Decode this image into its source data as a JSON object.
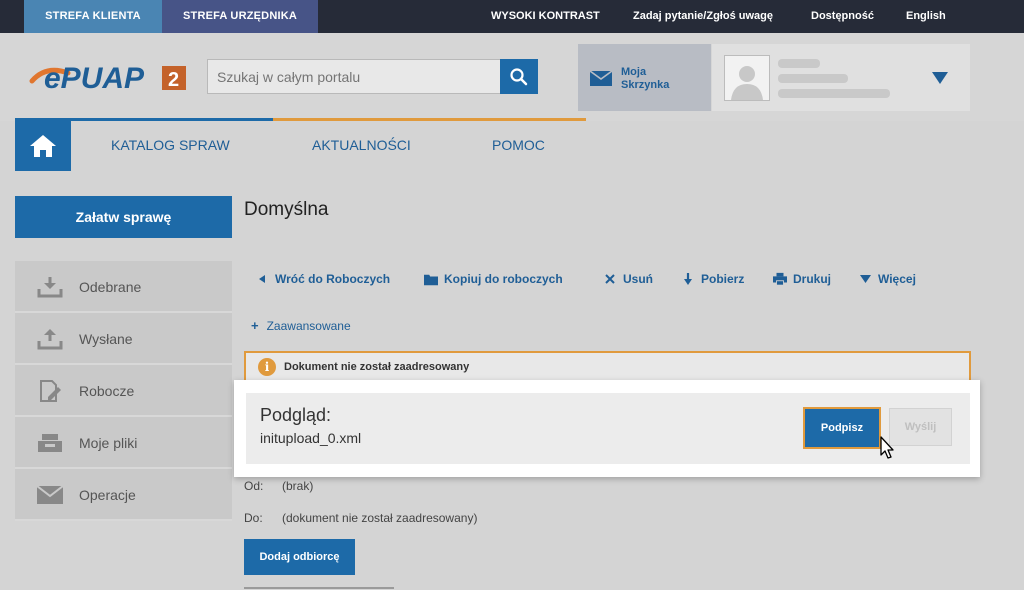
{
  "topbar": {
    "zone_klienta": "STREFA KLIENTA",
    "zone_urzednika": "STREFA URZĘDNIKA",
    "links": [
      "WYSOKI KONTRAST",
      "Zadaj pytanie/Zgłoś uwagę",
      "Dostępność",
      "English"
    ]
  },
  "header": {
    "logo_text": "ePUAP",
    "logo_badge": "2",
    "search_placeholder": "Szukaj w całym portalu",
    "inbox_line1": "Moja",
    "inbox_line2": "Skrzynka"
  },
  "nav": {
    "items": [
      "KATALOG SPRAW",
      "AKTUALNOŚCI",
      "POMOC"
    ]
  },
  "sidebar": {
    "cta": "Załatw sprawę",
    "items": [
      {
        "label": "Odebrane",
        "icon": "download-icon"
      },
      {
        "label": "Wysłane",
        "icon": "upload-icon"
      },
      {
        "label": "Robocze",
        "icon": "draft-icon"
      },
      {
        "label": "Moje pliki",
        "icon": "inbox-tray-icon"
      },
      {
        "label": "Operacje",
        "icon": "envelope-icon"
      }
    ]
  },
  "main": {
    "title": "Domyślna",
    "toolbar": [
      "Wróć do Roboczych",
      "Kopiuj do roboczych",
      "Usuń",
      "Pobierz",
      "Drukuj",
      "Więcej"
    ],
    "advanced": "Zaawansowane",
    "warning": "Dokument nie został zaadresowany",
    "preview_title": "Podgląd:",
    "preview_file": "initupload_0.xml",
    "sign_button": "Podpisz",
    "send_button": "Wyślij",
    "from_label": "Od:",
    "from_value": "(brak)",
    "to_label": "Do:",
    "to_value": "(dokument nie został zaadresowany)",
    "add_recipient": "Dodaj odbiorcę"
  },
  "colors": {
    "primary": "#1d6aa8",
    "accent_orange": "#e09a3d",
    "topbar": "#262b38",
    "zone_klienta": "#4a85b3",
    "zone_urzednika": "#475487"
  }
}
